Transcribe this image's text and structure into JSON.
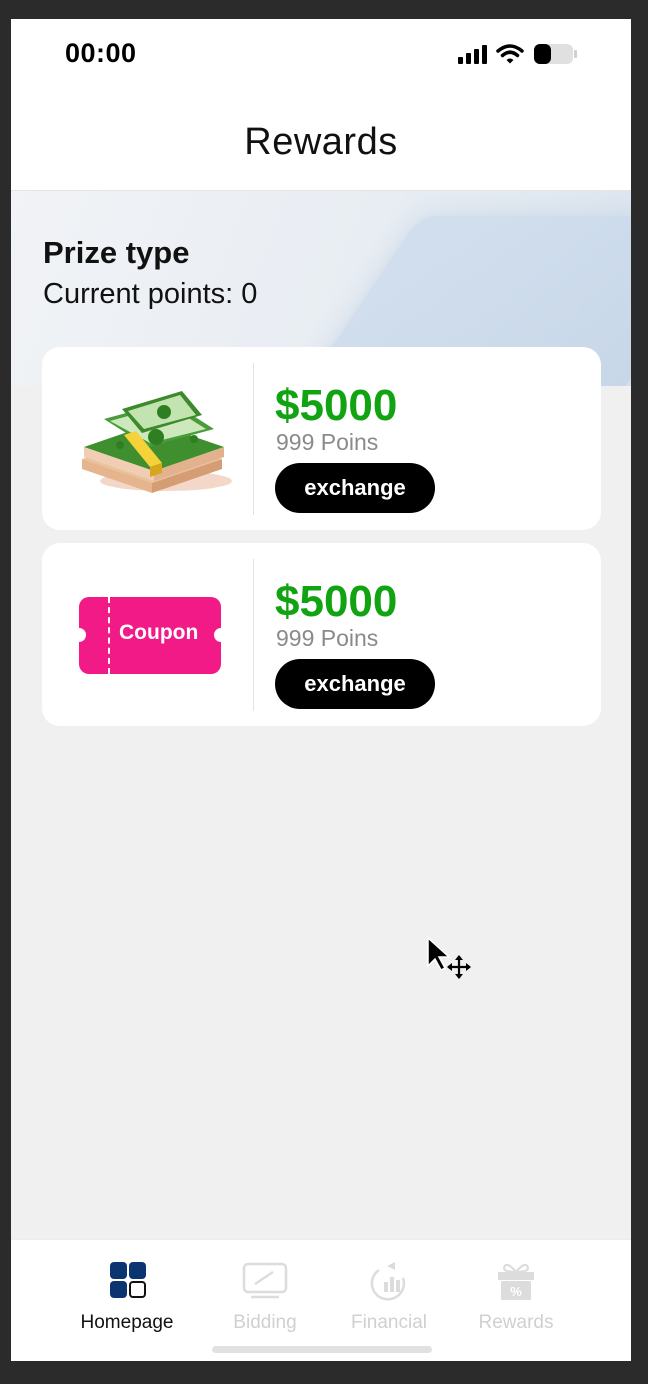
{
  "status_bar": {
    "time": "00:00"
  },
  "header": {
    "title": "Rewards"
  },
  "banner": {
    "heading": "Prize type",
    "points_text": "Current points: 0"
  },
  "cards": [
    {
      "image": "cash-stack-image",
      "price": "$5000",
      "points": "999 Poins",
      "button_label": "exchange"
    },
    {
      "image": "coupon-ticket-image",
      "image_text": "Coupon",
      "price": "$5000",
      "points": "999 Poins",
      "button_label": "exchange"
    }
  ],
  "tabbar": {
    "items": [
      {
        "label": "Homepage",
        "icon": "grid-icon",
        "active": true
      },
      {
        "label": "Bidding",
        "icon": "monitor-icon",
        "active": false
      },
      {
        "label": "Financial",
        "icon": "chart-icon",
        "active": false
      },
      {
        "label": "Rewards",
        "icon": "gift-icon",
        "active": false
      }
    ]
  },
  "colors": {
    "price_green": "#12a312",
    "coupon_pink": "#f11a86",
    "active_tab_navy": "#0b3470",
    "inactive_tab": "#d0d0d0"
  }
}
